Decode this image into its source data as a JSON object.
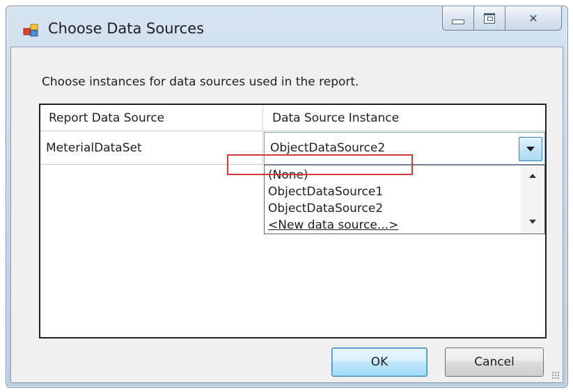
{
  "window": {
    "title": "Choose Data Sources",
    "controls": {
      "minimize": "minimize",
      "maximize": "maximize",
      "close": "✕"
    }
  },
  "instruction": "Choose instances for data sources used in the report.",
  "grid": {
    "columns": [
      "Report Data Source",
      "Data Source Instance"
    ],
    "rows": [
      {
        "report_data_source": "MeterialDataSet",
        "data_source_instance": "ObjectDataSource2"
      }
    ]
  },
  "dropdown": {
    "options": [
      "(None)",
      "ObjectDataSource1",
      "ObjectDataSource2",
      "<New data source...>"
    ],
    "selected": "ObjectDataSource2",
    "highlighted": "<New data source...>"
  },
  "buttons": {
    "ok": "OK",
    "cancel": "Cancel"
  },
  "colors": {
    "highlight_box": "#d23a3a",
    "ok_border": "#3c7fb1"
  }
}
